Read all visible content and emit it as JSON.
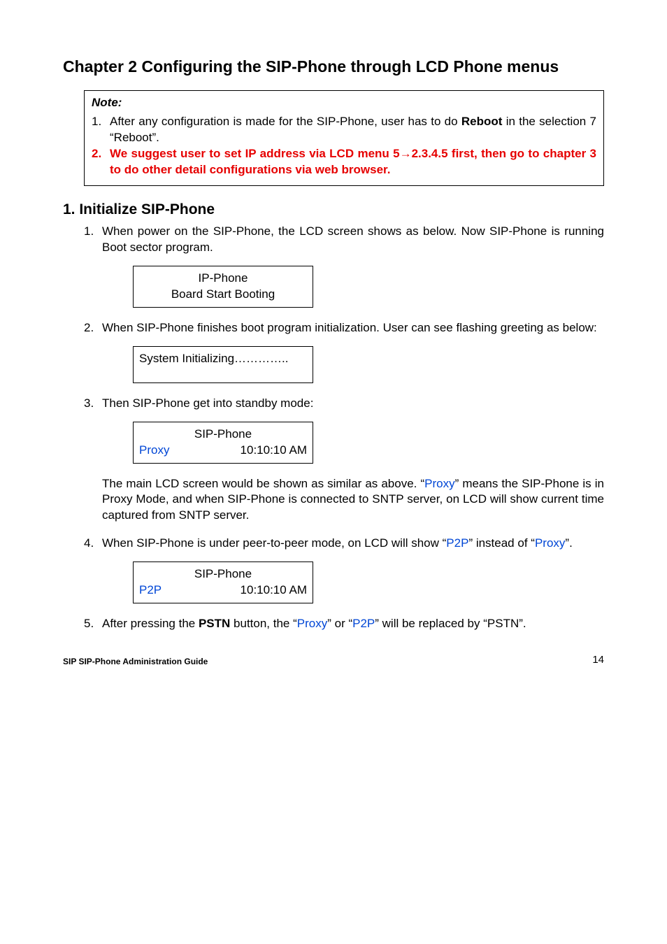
{
  "chapterTitle": "Chapter 2 Configuring the SIP-Phone through LCD Phone menus",
  "note": {
    "title": "Note:",
    "items": [
      {
        "num": "1.",
        "pre": "After any configuration is made for the SIP-Phone, user has to do ",
        "bold": "Reboot",
        "post": " in the selection 7 “Reboot”."
      },
      {
        "num": "2.",
        "red": "We suggest user to set IP address via LCD menu 5→2.3.4.5 first, then go to chapter 3 to do other detail configurations via web browser."
      }
    ]
  },
  "sectionTitle": "1. Initialize SIP-Phone",
  "steps": {
    "s1": {
      "num": "1.",
      "text": "When power on the SIP-Phone, the LCD screen shows as below. Now SIP-Phone is running Boot sector program."
    },
    "s2": {
      "num": "2.",
      "text": "When SIP-Phone finishes boot program initialization. User can see flashing greeting as below:"
    },
    "s3": {
      "num": "3.",
      "text": "Then SIP-Phone get into standby mode:"
    },
    "s3para": {
      "pre": "The main LCD screen would be shown as similar as above. “",
      "blue1": "Proxy",
      "mid": "” means the SIP-Phone is in Proxy Mode, and when SIP-Phone is connected to SNTP server, on LCD will show current time captured from SNTP server."
    },
    "s4": {
      "num": "4.",
      "pre": "When SIP-Phone is under peer-to-peer mode, on LCD will show “",
      "blue1": "P2P",
      "mid": "” instead of “",
      "blue2": "Proxy",
      "post": "”."
    },
    "s5": {
      "num": "5.",
      "pre": "After pressing the ",
      "bold": "PSTN",
      "mid": " button, the “",
      "blue1": "Proxy",
      "mid2": "” or “",
      "blue2": "P2P",
      "post": "” will be replaced by “PSTN”."
    }
  },
  "lcd": {
    "box1line1": "IP-Phone",
    "box1line2": "Board Start Booting",
    "box2line1": "System Initializing…………..",
    "box3line1": "SIP-Phone",
    "box3left": "Proxy",
    "box3right": "10:10:10 AM",
    "box4line1": "SIP-Phone",
    "box4left": "P2P",
    "box4right": "10:10:10 AM"
  },
  "footer": {
    "left": "SIP SIP-Phone    Administration Guide",
    "right": "14"
  }
}
